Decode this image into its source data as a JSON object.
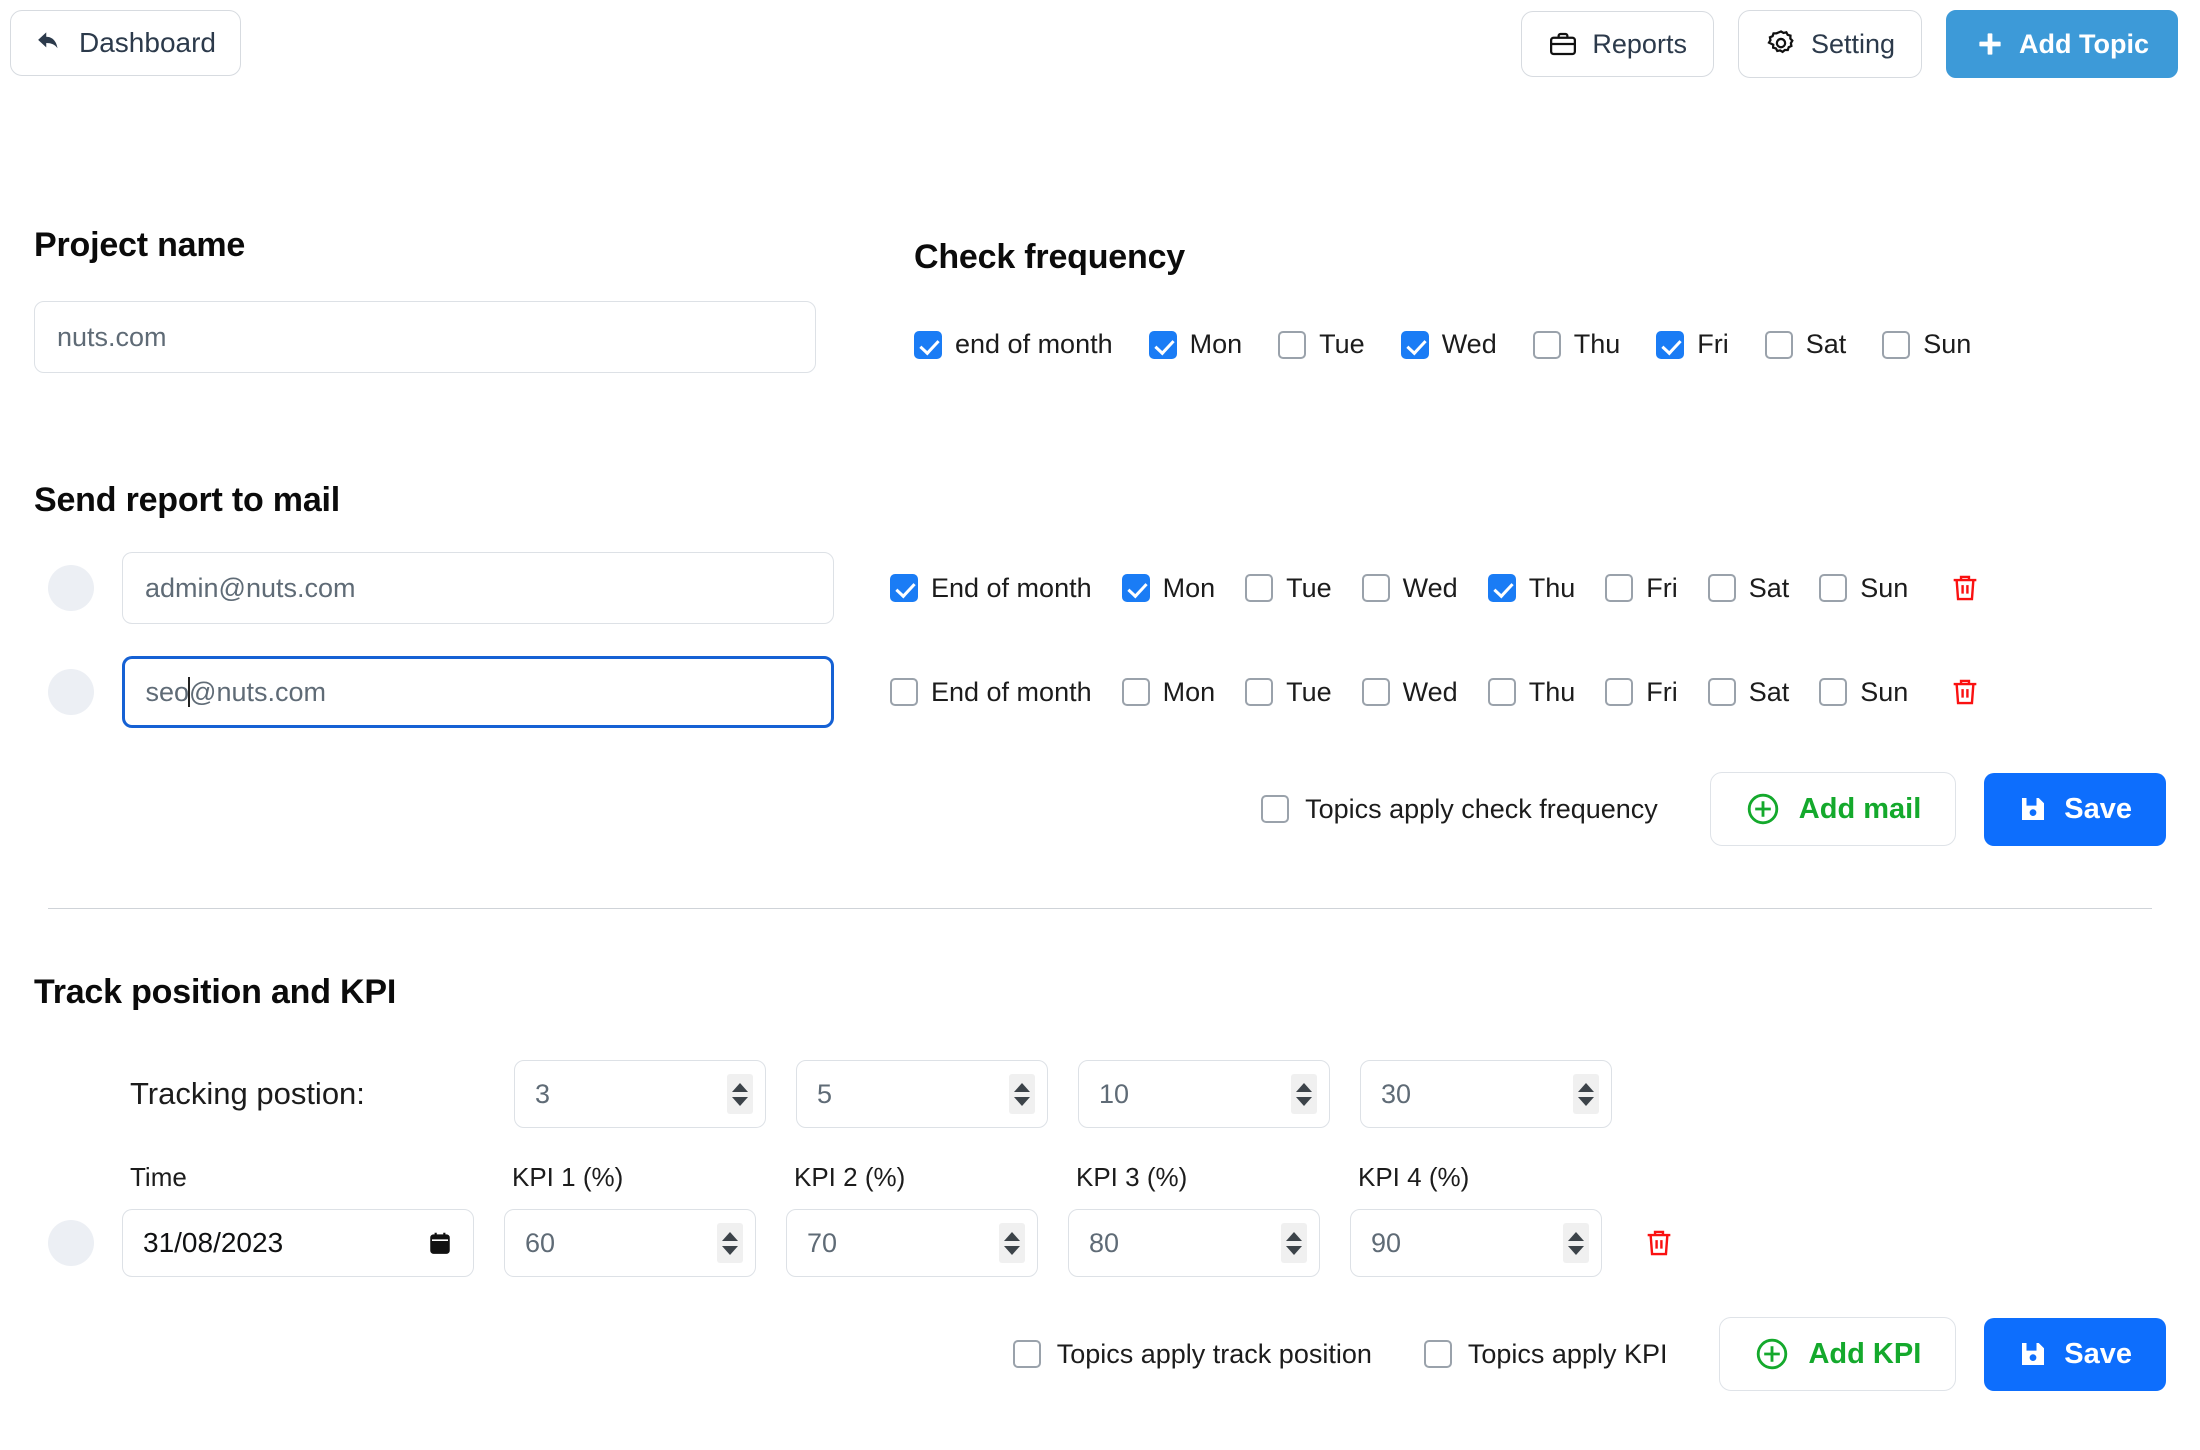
{
  "topbar": {
    "dashboard_label": "Dashboard",
    "reports_label": "Reports",
    "setting_label": "Setting",
    "add_topic_label": "Add Topic"
  },
  "project": {
    "title": "Project name",
    "value": "nuts.com"
  },
  "check_frequency": {
    "title": "Check frequency",
    "items": [
      {
        "label": "end of month",
        "checked": true
      },
      {
        "label": "Mon",
        "checked": true
      },
      {
        "label": "Tue",
        "checked": false
      },
      {
        "label": "Wed",
        "checked": true
      },
      {
        "label": "Thu",
        "checked": false
      },
      {
        "label": "Fri",
        "checked": true
      },
      {
        "label": "Sat",
        "checked": false
      },
      {
        "label": "Sun",
        "checked": false
      }
    ]
  },
  "mail": {
    "title": "Send report to mail",
    "rows": [
      {
        "email": "admin@nuts.com",
        "focused": false,
        "days": [
          {
            "label": "End of month",
            "checked": true
          },
          {
            "label": "Mon",
            "checked": true
          },
          {
            "label": "Tue",
            "checked": false
          },
          {
            "label": "Wed",
            "checked": false
          },
          {
            "label": "Thu",
            "checked": true
          },
          {
            "label": "Fri",
            "checked": false
          },
          {
            "label": "Sat",
            "checked": false
          },
          {
            "label": "Sun",
            "checked": false
          }
        ]
      },
      {
        "email_before_caret": "seo",
        "email_after_caret": "@nuts.com",
        "email": "seo@nuts.com",
        "focused": true,
        "days": [
          {
            "label": "End of month",
            "checked": false
          },
          {
            "label": "Mon",
            "checked": false
          },
          {
            "label": "Tue",
            "checked": false
          },
          {
            "label": "Wed",
            "checked": false
          },
          {
            "label": "Thu",
            "checked": false
          },
          {
            "label": "Fri",
            "checked": false
          },
          {
            "label": "Sat",
            "checked": false
          },
          {
            "label": "Sun",
            "checked": false
          }
        ]
      }
    ],
    "apply_label": "Topics apply check frequency",
    "apply_checked": false,
    "add_label": "Add mail",
    "save_label": "Save"
  },
  "kpi": {
    "title": "Track position and KPI",
    "tracking_label": "Tracking postion:",
    "positions": [
      "3",
      "5",
      "10",
      "30"
    ],
    "time_label": "Time",
    "kpi_captions": [
      "KPI 1 (%)",
      "KPI 2 (%)",
      "KPI 3 (%)",
      "KPI 4 (%)"
    ],
    "date_value": "31/08/2023",
    "kpi_values": [
      "60",
      "70",
      "80",
      "90"
    ],
    "apply_track_label": "Topics apply track position",
    "apply_track_checked": false,
    "apply_kpi_label": "Topics apply KPI",
    "apply_kpi_checked": false,
    "add_label": "Add KPI",
    "save_label": "Save"
  },
  "colors": {
    "accent_blue": "#0d6efd",
    "topbar_blue": "#3d9ad8",
    "checkbox_blue": "#1a7cf5",
    "green": "#14a92c",
    "danger_red": "#fa1111"
  }
}
